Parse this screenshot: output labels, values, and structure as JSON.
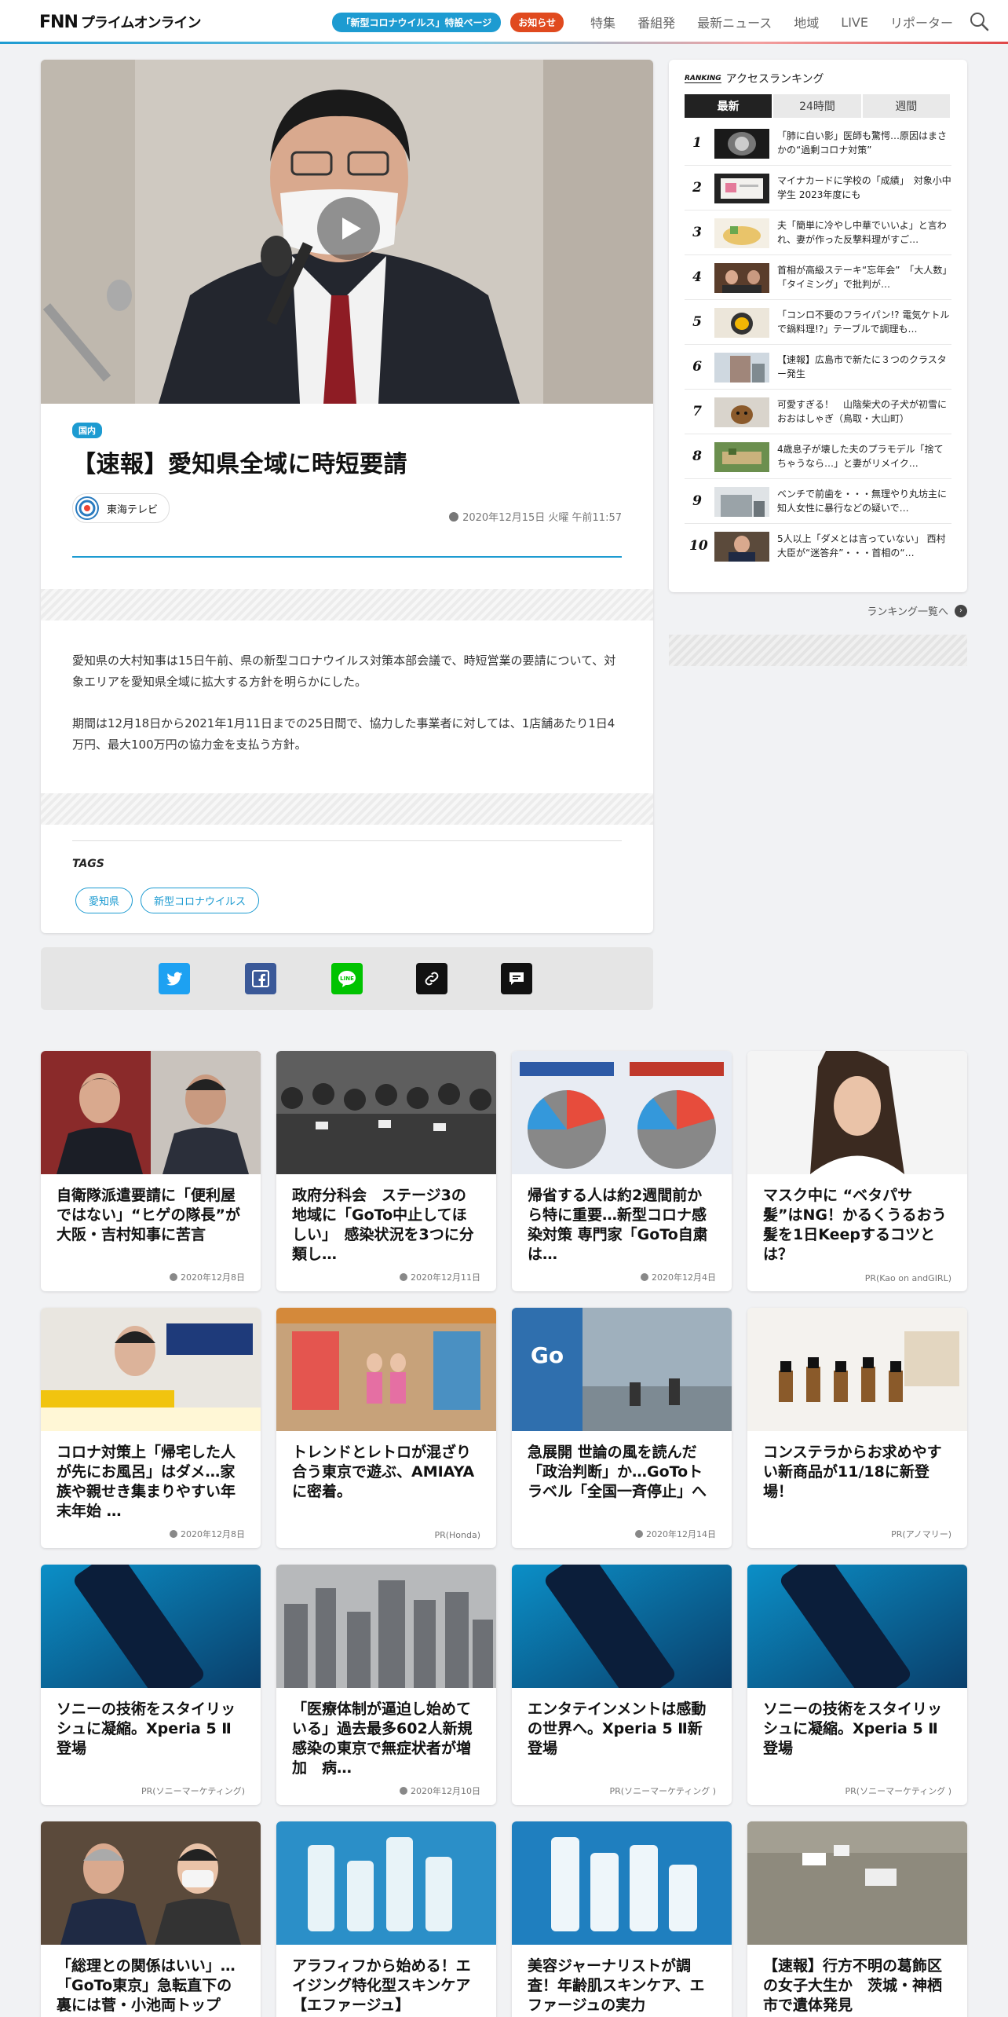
{
  "header": {
    "logo_fnn": "FNN",
    "logo_sub": "プライムオンライン",
    "corona_pill": "「新型コロナウイルス」特設ページ",
    "notice_pill": "お知らせ",
    "nav": [
      "特集",
      "番組発",
      "最新ニュース",
      "地域",
      "LIVE",
      "リポーター"
    ]
  },
  "article": {
    "category": "国内",
    "title": "【速報】愛知県全域に時短要請",
    "source": "東海テレビ",
    "date": "2020年12月15日 火曜 午前11:57",
    "paragraphs": [
      "愛知県の大村知事は15日午前、県の新型コロナウイルス対策本部会議で、時短営業の要請について、対象エリアを愛知県全域に拡大する方針を明らかにした。",
      "期間は12月18日から2021年1月11日までの25日間で、協力した事業者に対しては、1店舗あたり1日4万円、最大100万円の協力金を支払う方針。"
    ],
    "tags_label": "TAGS",
    "tags": [
      "愛知県",
      "新型コロナウイルス"
    ]
  },
  "share": {
    "colors": {
      "twitter": "#1da1f2",
      "facebook": "#3b5998",
      "line": "#00c300",
      "link": "#111111",
      "comment": "#111111"
    }
  },
  "ranking": {
    "head_logo": "RANKING",
    "title": "アクセスランキング",
    "tabs": [
      "最新",
      "24時間",
      "週間"
    ],
    "items": [
      {
        "num": "1",
        "text": "「肺に白い影」医師も驚愕…原因はまさかの“過剰コロナ対策”"
      },
      {
        "num": "2",
        "text": "マイナカードに学校の「成績」　対象小中学生 2023年度にも"
      },
      {
        "num": "3",
        "text": "夫「簡単に冷やし中華でいいよ」と言われ、妻が作った反撃料理がすご…"
      },
      {
        "num": "4",
        "text": "首相が高級ステーキ“忘年会”　「大人数」「タイミング」で批判が…"
      },
      {
        "num": "5",
        "text": "「コンロ不要のフライパン!? 電気ケトルで鍋料理!?」テーブルで調理も…"
      },
      {
        "num": "6",
        "text": "【速報】広島市で新たに３つのクラスター発生"
      },
      {
        "num": "7",
        "text": "可愛すぎる！　山陰柴犬の子犬が初雪におおはしゃぎ（鳥取・大山町）"
      },
      {
        "num": "8",
        "text": "4歳息子が壊した夫のプラモデル「捨てちゃうなら…」と妻がリメイク…"
      },
      {
        "num": "9",
        "text": "ベンチで前歯を・・・無理やり丸坊主に　知人女性に暴行などの疑いで…"
      },
      {
        "num": "10",
        "text": "5人以上「ダメとは言っていない」 西村大臣が“迷答弁”・・・首相の“…"
      }
    ],
    "more": "ランキング一覧へ"
  },
  "cards": [
    {
      "title": "自衛隊派遣要請に「便利屋ではない」“ヒゲの隊長”が大阪・吉村知事に苦言",
      "meta": "2020年12月8日",
      "clock": true
    },
    {
      "title": "政府分科会　ステージ3の地域に「GoTo中止してほしい」　感染状況を3つに分類し…",
      "meta": "2020年12月11日",
      "clock": true
    },
    {
      "title": "帰省する人は約2週間前から特に重要…新型コロナ感染対策 専門家「GoTo自粛は…",
      "meta": "2020年12月4日",
      "clock": true
    },
    {
      "title": "マスク中に “ベタパサ髪”はNG！かるくうるおう髪を1日Keepするコツとは？",
      "meta": "PR(Kao on andGIRL)",
      "clock": false
    },
    {
      "title": "コロナ対策上「帰宅した人が先にお風呂」はダメ…家族や親せき集まりやすい年末年始 …",
      "meta": "2020年12月8日",
      "clock": true
    },
    {
      "title": "トレンドとレトロが混ざり合う東京で遊ぶ、AMIAYAに密着。",
      "meta": "PR(Honda)",
      "clock": false
    },
    {
      "title": "急展開 世論の風を読んだ「政治判断」か…GoToトラベル「全国一斉停止」へ",
      "meta": "2020年12月14日",
      "clock": true
    },
    {
      "title": "コンステラからお求めやすい新商品が11/18に新登場！",
      "meta": "PR(アノマリー)",
      "clock": false
    },
    {
      "title": "ソニーの技術をスタイリッシュに凝縮。Xperia 5 Ⅱ登場",
      "meta": "PR(ソニーマーケティング)",
      "clock": false
    },
    {
      "title": "「医療体制が逼迫し始めている」過去最多602人新規感染の東京で無症状者が増加　病…",
      "meta": "2020年12月10日",
      "clock": true
    },
    {
      "title": "エンタテインメントは感動の世界へ。Xperia 5 Ⅱ新登場",
      "meta": "PR(ソニーマーケティング )",
      "clock": false
    },
    {
      "title": "ソニーの技術をスタイリッシュに凝縮。Xperia 5 Ⅱ登場",
      "meta": "PR(ソニーマーケティング )",
      "clock": false
    },
    {
      "title": "「総理との関係はいい」…「GoTo東京」急転直下の裏には菅・小池両トップの…",
      "meta": "",
      "clock": false
    },
    {
      "title": "アラフィフから始める！エイジング特化型スキンケア【エファージュ】",
      "meta": "",
      "clock": false
    },
    {
      "title": "美容ジャーナリストが調査！年齢肌スキンケア、エファージュの実力",
      "meta": "",
      "clock": false
    },
    {
      "title": "【速報】行方不明の葛飾区の女子大生か　茨城・神栖市で遺体発見",
      "meta": "",
      "clock": false
    }
  ]
}
